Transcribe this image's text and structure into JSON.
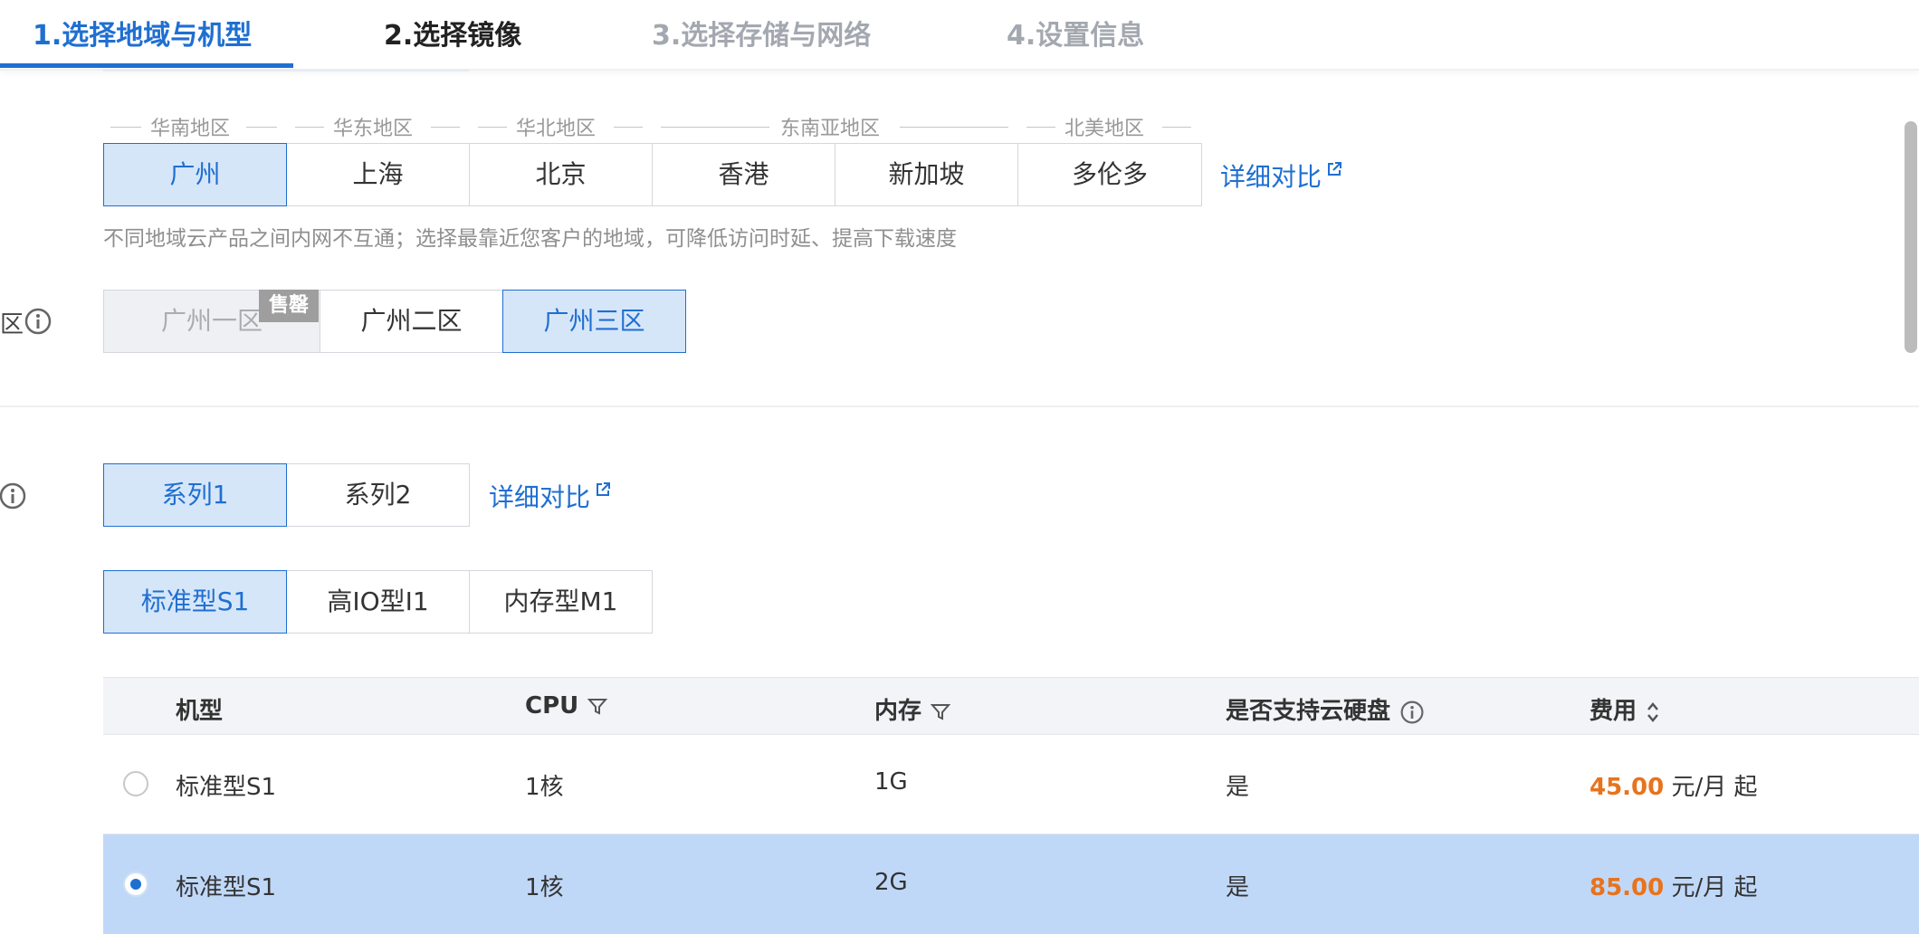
{
  "steps": [
    {
      "label": "1.选择地域与机型",
      "state": "active"
    },
    {
      "label": "2.选择镜像",
      "state": "done"
    },
    {
      "label": "3.选择存储与网络",
      "state": "todo"
    },
    {
      "label": "4.设置信息",
      "state": "todo"
    }
  ],
  "region_groups": [
    "华南地区",
    "华东地区",
    "华北地区",
    "东南亚地区",
    "北美地区"
  ],
  "regions": [
    "广州",
    "上海",
    "北京",
    "香港",
    "新加坡",
    "多伦多"
  ],
  "selected_region": "广州",
  "region_compare_link": "详细对比",
  "region_hint": "不同地域云产品之间内网不互通；选择最靠近您客户的地域，可降低访问时延、提高下载速度",
  "zone_label_partial": "区",
  "zones": [
    {
      "label": "广州一区",
      "state": "disabled",
      "badge": "售罄"
    },
    {
      "label": "广州二区",
      "state": "normal"
    },
    {
      "label": "广州三区",
      "state": "selected"
    }
  ],
  "series": [
    "系列1",
    "系列2"
  ],
  "selected_series": "系列1",
  "series_compare_link": "详细对比",
  "instance_types": [
    "标准型S1",
    "高IO型I1",
    "内存型M1"
  ],
  "selected_instance_type": "标准型S1",
  "table": {
    "headers": {
      "model": "机型",
      "cpu": "CPU",
      "memory": "内存",
      "cloud_disk": "是否支持云硬盘",
      "price": "费用"
    },
    "rows": [
      {
        "model": "标准型S1",
        "cpu": "1核",
        "memory": "1G",
        "cloud_disk": "是",
        "price": "45.00",
        "price_unit": "元/月 起",
        "selected": false
      },
      {
        "model": "标准型S1",
        "cpu": "1核",
        "memory": "2G",
        "cloud_disk": "是",
        "price": "85.00",
        "price_unit": "元/月 起",
        "selected": true
      }
    ]
  },
  "colors": {
    "accent": "#1f6fd1",
    "selected_bg": "#d6e6f9",
    "selected_row_bg": "#c0d8f8",
    "price": "#e8731c",
    "disabled_badge": "#9e9e9e"
  },
  "icons": [
    "info-icon",
    "external-link-icon",
    "filter-icon",
    "sort-icon",
    "radio-icon"
  ]
}
